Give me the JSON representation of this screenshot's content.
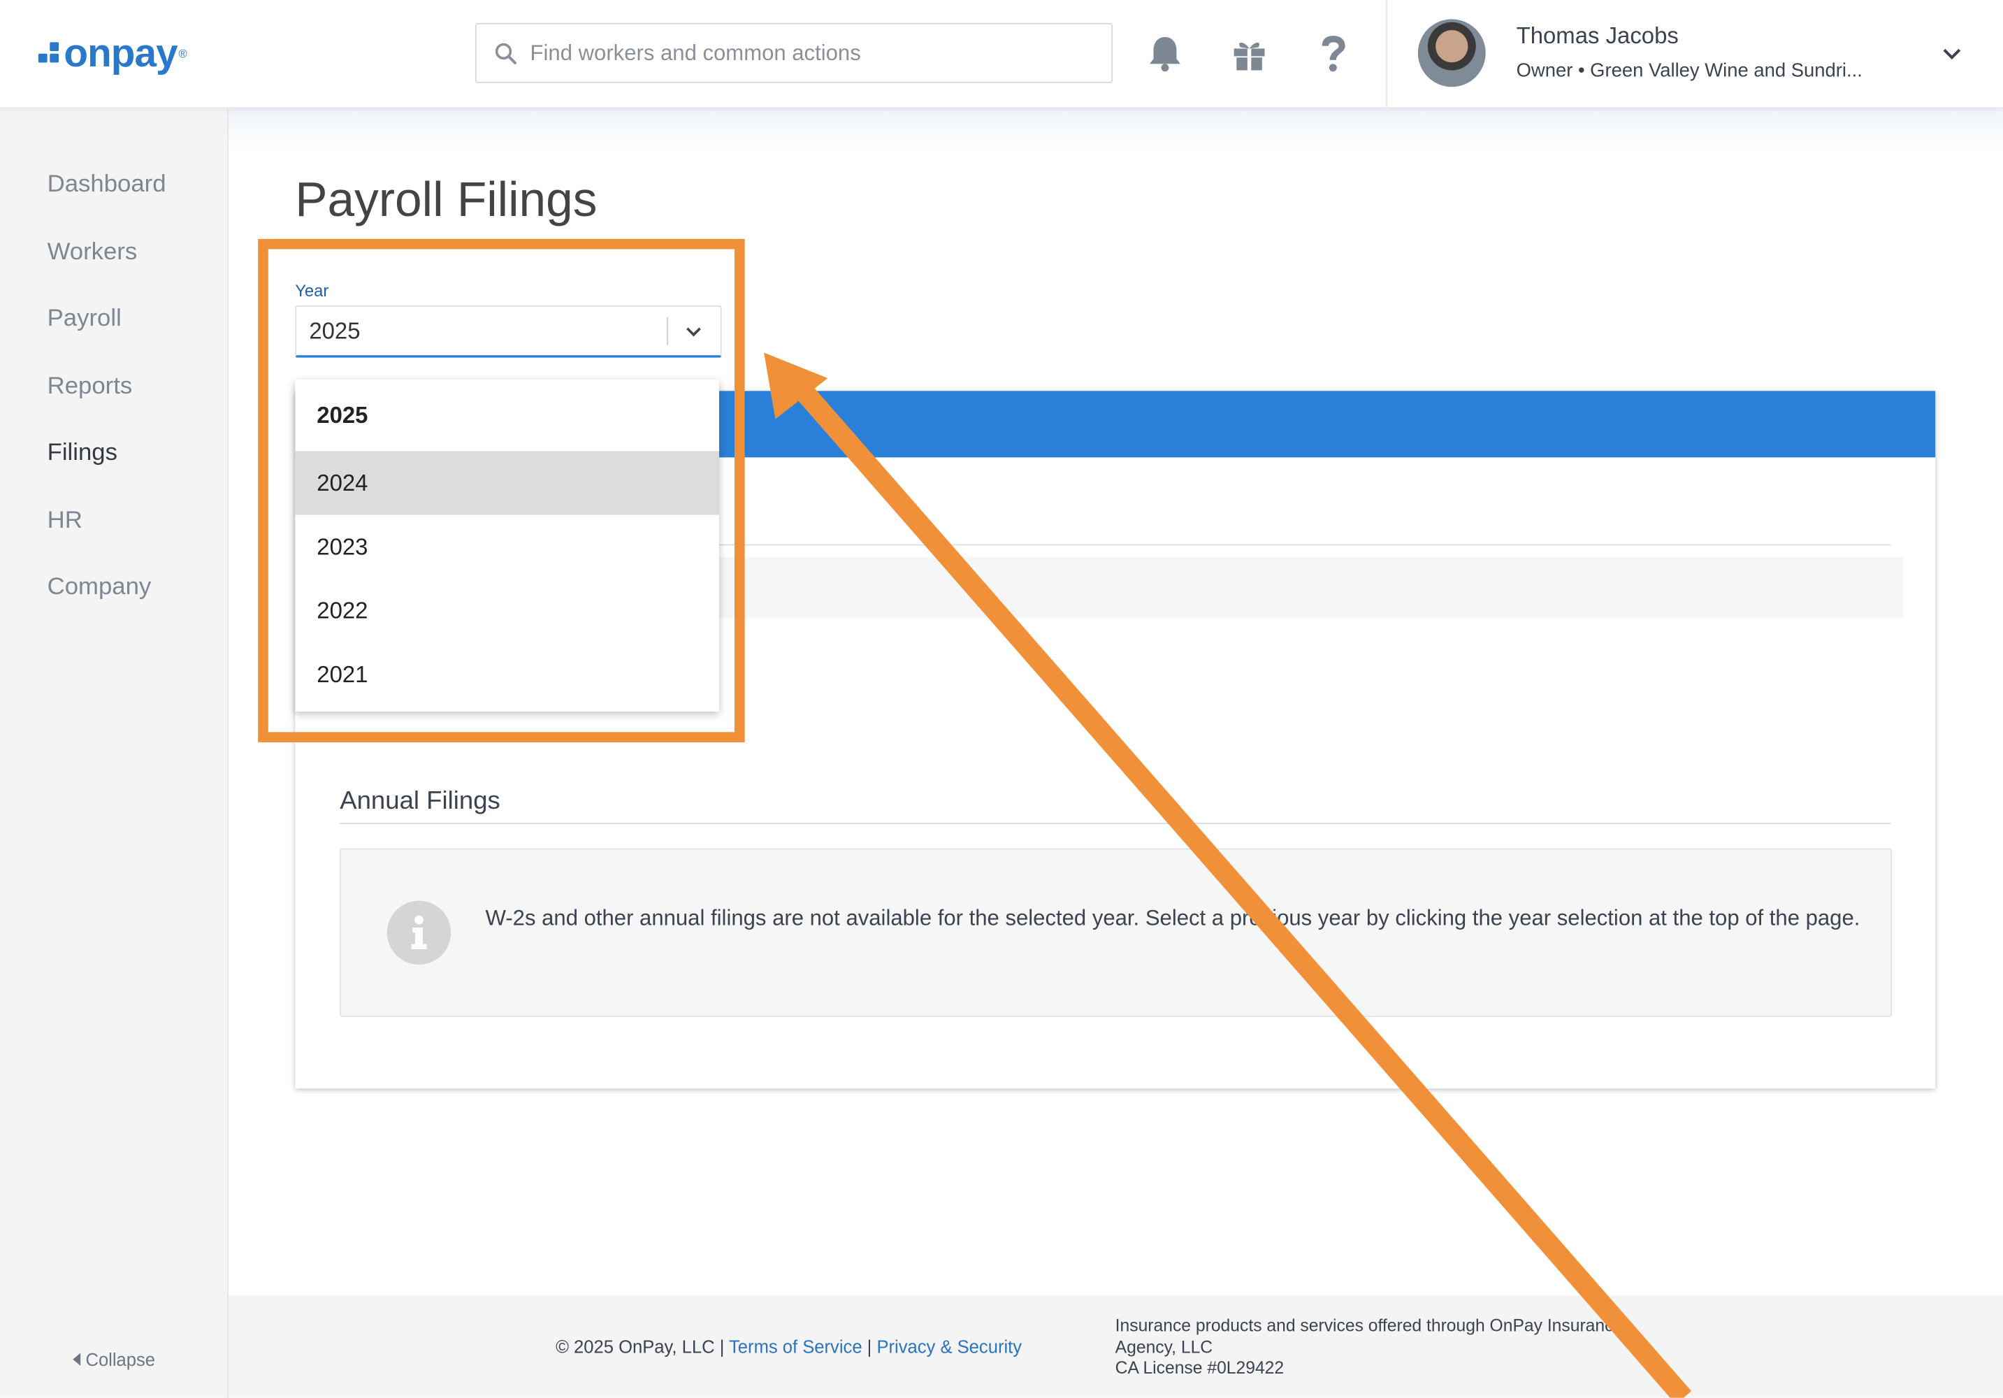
{
  "header": {
    "logo_text": "onpay",
    "logo_mark": "®",
    "search_placeholder": "Find workers and common actions",
    "icons": [
      "bell-icon",
      "gift-icon",
      "help-icon"
    ],
    "user": {
      "name": "Thomas Jacobs",
      "role": "Owner • Green Valley Wine and Sundri..."
    }
  },
  "sidebar": {
    "items": [
      {
        "label": "Dashboard",
        "active": false
      },
      {
        "label": "Workers",
        "active": false
      },
      {
        "label": "Payroll",
        "active": false
      },
      {
        "label": "Reports",
        "active": false
      },
      {
        "label": "Filings",
        "active": true
      },
      {
        "label": "HR",
        "active": false
      },
      {
        "label": "Company",
        "active": false
      }
    ],
    "collapse_label": "Collapse"
  },
  "page": {
    "title": "Payroll Filings",
    "year_label": "Year",
    "year_value": "2025",
    "year_options": [
      "2025",
      "2024",
      "2023",
      "2022",
      "2021"
    ],
    "hovered_option": "2024",
    "annual_title": "Annual Filings",
    "annual_info": "W-2s and other annual filings are not available for the selected year. Select a previous year by clicking the year selection at the top of the page."
  },
  "footer": {
    "copyright": "© 2025 OnPay, LLC |",
    "terms": "Terms of Service",
    "sep": "|",
    "privacy": "Privacy & Security",
    "insurance_line1": "Insurance products and services offered through OnPay Insurance",
    "insurance_line2": "Agency, LLC",
    "insurance_line3": "CA License #0L29422"
  },
  "colors": {
    "brand": "#2a78c9",
    "accent_band": "#2a80d9",
    "highlight": "#f0913a"
  }
}
